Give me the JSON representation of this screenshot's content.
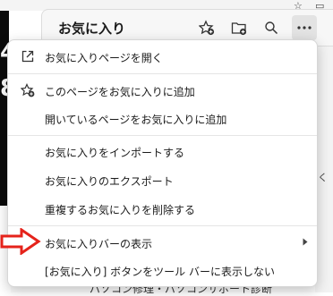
{
  "panel": {
    "title": "お気に入り"
  },
  "background": {
    "left_glyphs": [
      "4",
      "8"
    ],
    "bottom_text": "パソコン修理・パソコンサポート診断"
  },
  "menu": {
    "items": [
      {
        "label": "お気に入りページを開く",
        "icon": "open-external-icon"
      },
      {
        "label": "このページをお気に入りに追加",
        "icon": "star-add-icon"
      },
      {
        "label": "開いているページをお気に入りに追加"
      },
      {
        "label": "お気に入りをインポートする"
      },
      {
        "label": "お気に入りのエクスポート"
      },
      {
        "label": "重複するお気に入りを削除する"
      },
      {
        "label": "お気に入りバーの表示",
        "has_submenu": true
      },
      {
        "label": "[お気に入り] ボタンをツール バーに表示しない"
      }
    ]
  },
  "colors": {
    "annotation_arrow": "#e5231b"
  }
}
